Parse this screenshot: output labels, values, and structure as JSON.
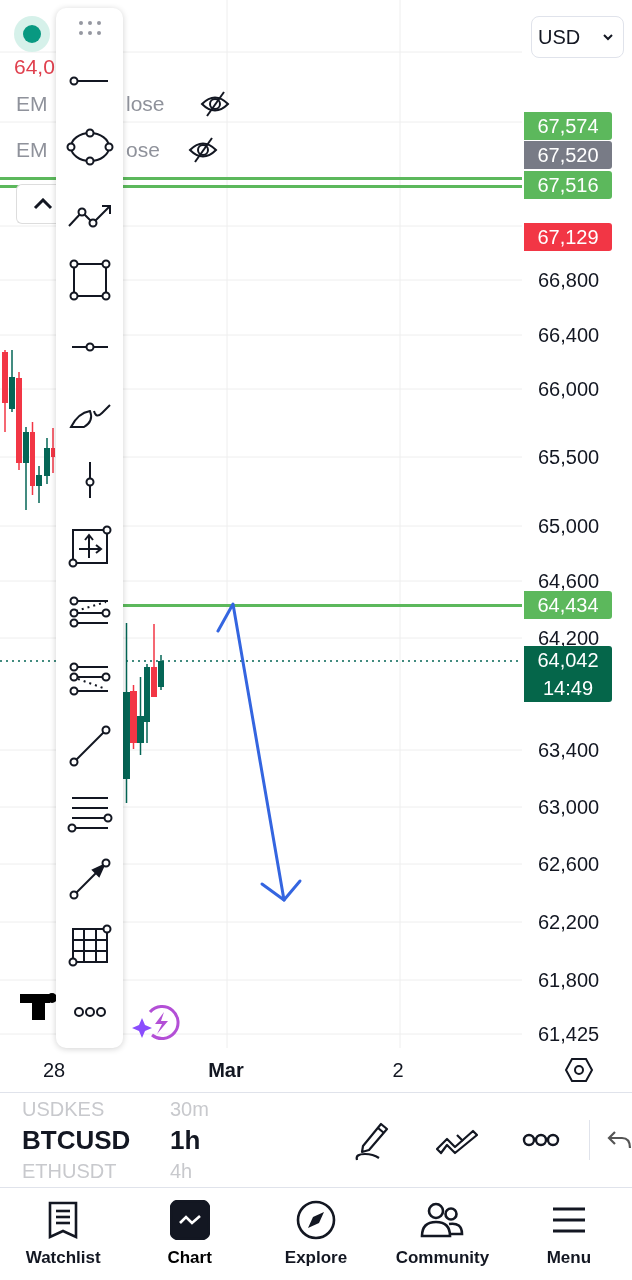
{
  "header": {
    "price": "64,0"
  },
  "indicators": [
    {
      "name": "EM",
      "source": "lose",
      "visible": false
    },
    {
      "name": "EM",
      "source": "ose",
      "visible": false
    }
  ],
  "currency": "USD",
  "price_axis": [
    "66,800",
    "66,400",
    "66,000",
    "65,500",
    "65,000",
    "64,600",
    "64,200",
    "63,400",
    "63,000",
    "62,600",
    "62,200",
    "61,800",
    "61,425"
  ],
  "price_tags": [
    {
      "value": "67,574",
      "color": "#5cb85c"
    },
    {
      "value": "67,520",
      "color": "#787b86"
    },
    {
      "value": "67,516",
      "color": "#5cb85c"
    },
    {
      "value": "67,129",
      "color": "#f23645"
    },
    {
      "value": "64,434",
      "color": "#5cb85c"
    },
    {
      "value": "64,042",
      "time": "14:49",
      "color": "#05664a"
    }
  ],
  "time_axis": [
    {
      "label": "28",
      "kind": "day"
    },
    {
      "label": "Mar",
      "kind": "month"
    },
    {
      "label": "2",
      "kind": "day"
    }
  ],
  "symbol_picker": {
    "symbols": [
      {
        "text": "USDKES",
        "selected": false
      },
      {
        "text": "BTCUSD",
        "selected": true
      },
      {
        "text": "ETHUSDT",
        "selected": false
      }
    ],
    "intervals": [
      {
        "text": "30m",
        "selected": false
      },
      {
        "text": "1h",
        "selected": true
      },
      {
        "text": "4h",
        "selected": false
      }
    ]
  },
  "nav": [
    {
      "label": "Watchlist",
      "selected": false
    },
    {
      "label": "Chart",
      "selected": true
    },
    {
      "label": "Explore",
      "selected": false
    },
    {
      "label": "Community",
      "selected": false
    },
    {
      "label": "Menu",
      "selected": false
    }
  ]
}
